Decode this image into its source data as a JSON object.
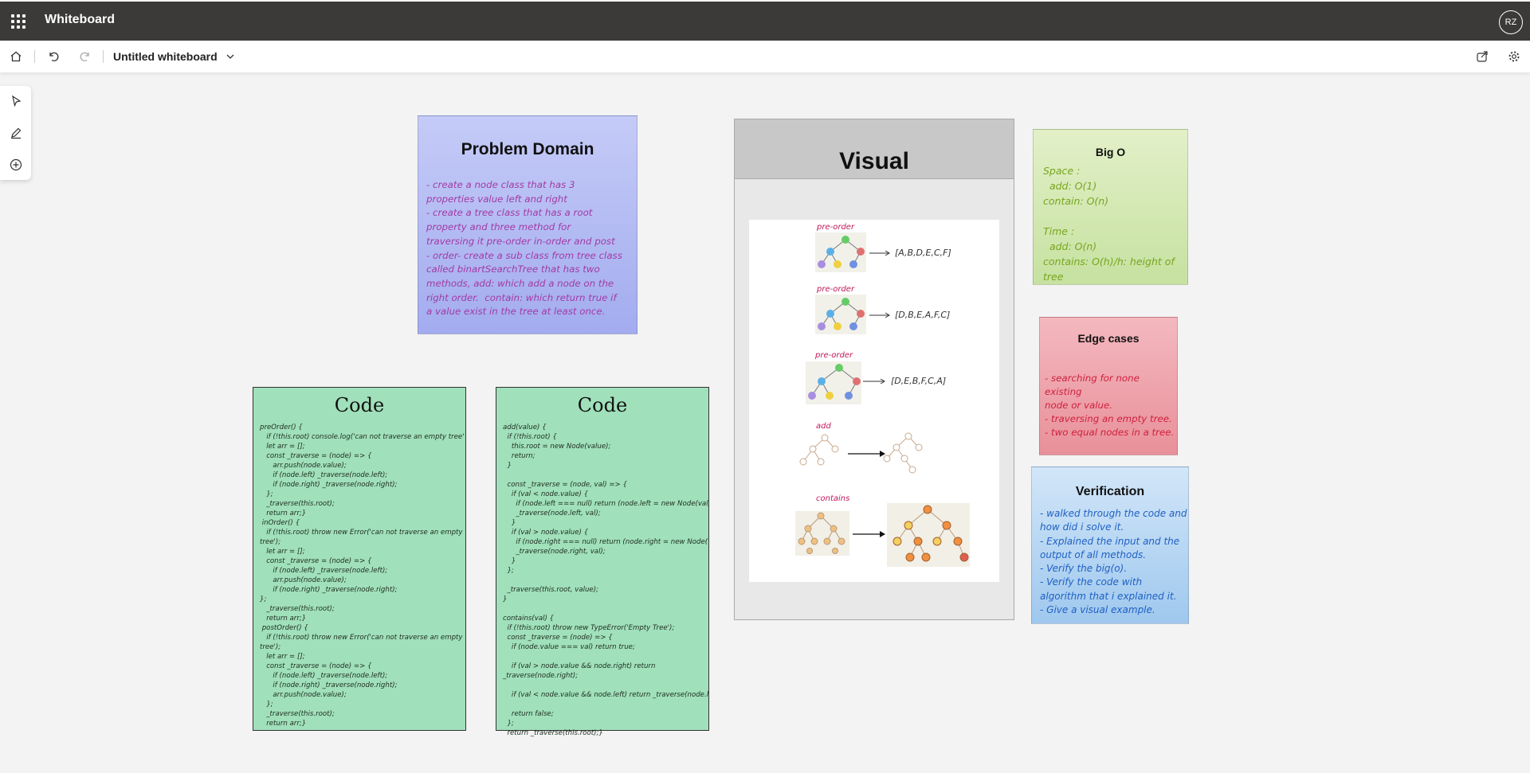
{
  "app": {
    "title": "Whiteboard",
    "user_initials": "RZ"
  },
  "toolbar": {
    "whiteboard_name": "Untitled whiteboard"
  },
  "problem": {
    "title": "Problem Domain",
    "lines": [
      "- create a node class that has 3",
      "properties value left and right",
      "- create a tree class that has a root",
      "property and three method for",
      "traversing it pre-order in-order and post",
      "- order- create a sub class from tree class",
      "called binartSearchTree that has two",
      "methods, add: which add a node on the",
      "right order.  contain: which return true if",
      "a value exist in the tree at least once."
    ]
  },
  "visual": {
    "title": "Visual",
    "sections": [
      {
        "label": "pre-order",
        "result": "[A,B,D,E,C,F]"
      },
      {
        "label": "pre-order",
        "result": "[D,B,E,A,F,C]"
      },
      {
        "label": "pre-order",
        "result": "[D,E,B,F,C,A]"
      },
      {
        "label": "add",
        "result": ""
      },
      {
        "label": "contains",
        "result": ""
      }
    ]
  },
  "bigo": {
    "title": "Big O",
    "lines": [
      "Space :",
      "  add: O(1)",
      "contain: O(n)",
      "",
      "Time :",
      "  add: O(n)",
      "contains: O(h)/h: height of",
      "tree"
    ]
  },
  "edge": {
    "title": "Edge cases",
    "lines": [
      "- searching for none existing",
      "node or value.",
      "- traversing an empty tree.",
      "- two equal nodes in a tree."
    ]
  },
  "verification": {
    "title": "Verification",
    "lines": [
      "- walked through the code and",
      "how did i solve it.",
      "- Explained the input and the",
      "output of all methods.",
      "- Verify the big(o).",
      "- Verify the code with",
      "algorithm that i explained it.",
      "- Give a visual example."
    ]
  },
  "code1": {
    "title": "Code",
    "text": "preOrder() {\n   if (!this.root) console.log('can not traverse an empty tree');\n   let arr = [];\n   const _traverse = (node) => {\n      arr.push(node.value);\n      if (node.left) _traverse(node.left);\n      if (node.right) _traverse(node.right);\n   };\n   _traverse(this.root);\n   return arr;}\n inOrder() {\n   if (!this.root) throw new Error('can not traverse an empty\ntree');\n   let arr = [];\n   const _traverse = (node) => {\n      if (node.left) _traverse(node.left);\n      arr.push(node.value);\n      if (node.right) _traverse(node.right);\n};\n   _traverse(this.root);\n   return arr;}\n postOrder() {\n   if (!this.root) throw new Error('can not traverse an empty\ntree');\n   let arr = [];\n   const _traverse = (node) => {\n      if (node.left) _traverse(node.left);\n      if (node.right) _traverse(node.right);\n      arr.push(node.value);\n   };\n   _traverse(this.root);\n   return arr;}"
  },
  "code2": {
    "title": "Code",
    "text": "add(value) {\n  if (!this.root) {\n    this.root = new Node(value);\n    return;\n  }\n\n  const _traverse = (node, val) => {\n    if (val < node.value) {\n      if (node.left === null) return (node.left = new Node(val));\n      _traverse(node.left, val);\n    }\n    if (val > node.value) {\n      if (node.right === null) return (node.right = new Node(val));\n      _traverse(node.right, val);\n    }\n  };\n\n  _traverse(this.root, value);\n}\n\ncontains(val) {\n  if (!this.root) throw new TypeError('Empty Tree');\n  const _traverse = (node) => {\n    if (node.value === val) return true;\n\n    if (val > node.value && node.right) return\n_traverse(node.right);\n\n    if (val < node.value && node.left) return _traverse(node.left);\n\n    return false;\n  };\n  return _traverse(this.root);}"
  }
}
